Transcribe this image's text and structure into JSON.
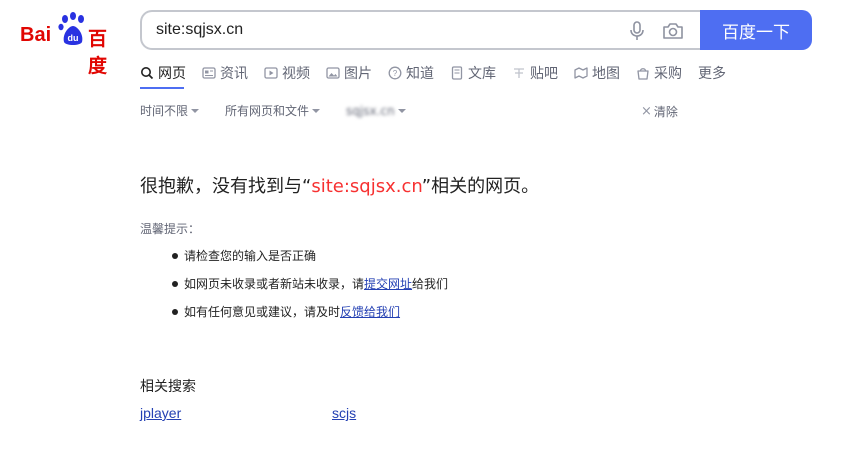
{
  "logo": {
    "bai": "Bai",
    "du": "du",
    "cn": "百度"
  },
  "search": {
    "value": "site:sqjsx.cn",
    "button_label": "百度一下"
  },
  "tabs": [
    {
      "label": "网页",
      "icon": "search-icon",
      "active": true
    },
    {
      "label": "资讯",
      "icon": "news-icon"
    },
    {
      "label": "视频",
      "icon": "video-icon"
    },
    {
      "label": "图片",
      "icon": "image-icon"
    },
    {
      "label": "知道",
      "icon": "question-icon"
    },
    {
      "label": "文库",
      "icon": "document-icon"
    },
    {
      "label": "贴吧",
      "icon": "tieba-icon"
    },
    {
      "label": "地图",
      "icon": "map-icon"
    },
    {
      "label": "采购",
      "icon": "shopping-icon"
    },
    {
      "label": "更多"
    }
  ],
  "filters": {
    "time": "时间不限",
    "type": "所有网页和文件",
    "site": "sqjsx.cn",
    "clear": "清除"
  },
  "no_result": {
    "prefix": "很抱歉，没有找到与“",
    "query": "site:sqjsx.cn",
    "suffix": "”相关的网页。"
  },
  "tips": {
    "title": "温馨提示：",
    "item1": "请检查您的输入是否正确",
    "item2_prefix": "如网页未收录或者新站未收录，请",
    "item2_link": "提交网址",
    "item2_suffix": "给我们",
    "item3_prefix": "如有任何意见或建议，请及时",
    "item3_link": "反馈给我们"
  },
  "related": {
    "title": "相关搜索",
    "items": [
      "jplayer",
      "scjs"
    ]
  },
  "colors": {
    "brand_blue": "#4e6ef2",
    "brand_red": "#e10602",
    "highlight_red": "#f73131",
    "link_blue": "#2440b3"
  }
}
